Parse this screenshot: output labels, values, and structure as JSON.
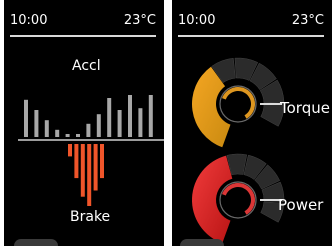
{
  "screens": {
    "left": {
      "time": "10:00",
      "temperature": "23°C",
      "accel_label": "Accl",
      "brake_label": "Brake",
      "accel_levels": [
        0.62,
        0.45,
        0.28,
        0.12,
        0.05,
        0.05,
        0.22,
        0.38,
        0.65,
        0.45,
        0.7,
        0.48,
        0.7
      ],
      "brake_levels": [
        0.2,
        0.55,
        0.85,
        1.0,
        0.75,
        0.55
      ],
      "colors": {
        "accel": "#a8a8a8",
        "brake": "#f0552a"
      }
    },
    "right": {
      "time": "10:00",
      "temperature": "23°C",
      "gauges": [
        {
          "label": "Torque",
          "level": 0.48,
          "color_start": "#f5a623",
          "color_end": "#c98a10"
        },
        {
          "label": "Power",
          "level": 0.55,
          "color_start": "#f23c3c",
          "color_end": "#b81414"
        }
      ]
    }
  }
}
